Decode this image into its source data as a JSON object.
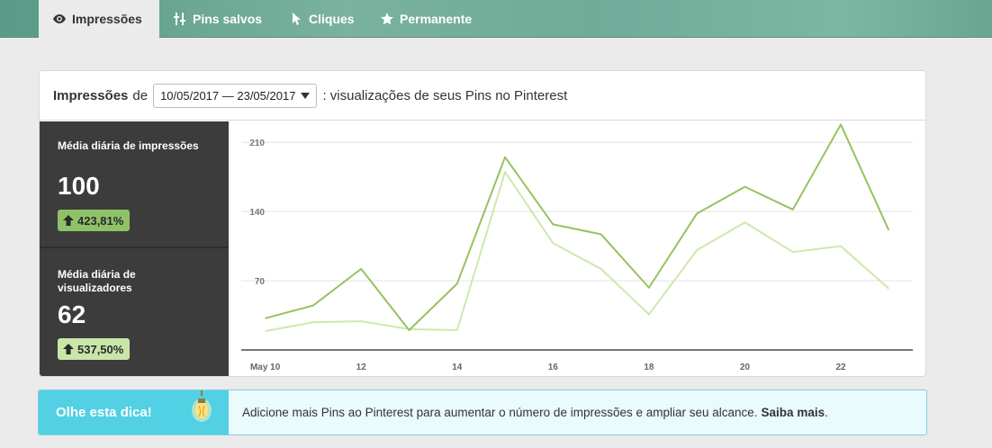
{
  "nav": {
    "tabs": [
      {
        "label": "Impressões",
        "icon": "eye-icon",
        "active": true
      },
      {
        "label": "Pins salvos",
        "icon": "pin-save-icon",
        "active": false
      },
      {
        "label": "Cliques",
        "icon": "cursor-icon",
        "active": false
      },
      {
        "label": "Permanente",
        "icon": "star-icon",
        "active": false
      }
    ]
  },
  "header": {
    "title": "Impressões",
    "prefix": "de",
    "date_range": "10/05/2017 — 23/05/2017",
    "suffix": ": visualizações de seus Pins no Pinterest"
  },
  "stats": [
    {
      "label": "Média diária de impressões",
      "value": "100",
      "change": "423,81%",
      "badge_color": "#8fc267"
    },
    {
      "label": "Média diária de visualizadores",
      "value": "62",
      "change": "537,50%",
      "badge_color": "#c9e6a9"
    }
  ],
  "tip": {
    "title": "Olhe esta dica!",
    "text": "Adicione mais Pins ao Pinterest para aumentar o número de impressões e ampliar seu alcance.",
    "link": "Saiba mais",
    "end": "."
  },
  "chart_data": {
    "type": "line",
    "x": [
      10,
      11,
      12,
      13,
      14,
      15,
      16,
      17,
      18,
      19,
      20,
      21,
      22,
      23
    ],
    "x_tick_labels": [
      "May 10",
      "12",
      "14",
      "16",
      "18",
      "20",
      "22"
    ],
    "x_tick_positions": [
      10,
      12,
      14,
      16,
      18,
      20,
      22
    ],
    "y_ticks": [
      70,
      140,
      210
    ],
    "ylim": [
      0,
      222
    ],
    "grid": true,
    "series": [
      {
        "values": [
          32,
          45,
          82,
          20,
          67,
          195,
          127,
          117,
          63,
          138,
          165,
          142,
          228,
          121
        ],
        "color": "#95c35f"
      },
      {
        "values": [
          19,
          28,
          29,
          21,
          20,
          180,
          108,
          82,
          36,
          101,
          129,
          99,
          105,
          62
        ],
        "color": "#cde8ad"
      }
    ]
  },
  "colors": {
    "accent": "#52d0e4",
    "panel": "#3c3c3c",
    "impressions_line": "#95c35f",
    "viewers_line": "#cde8ad"
  }
}
